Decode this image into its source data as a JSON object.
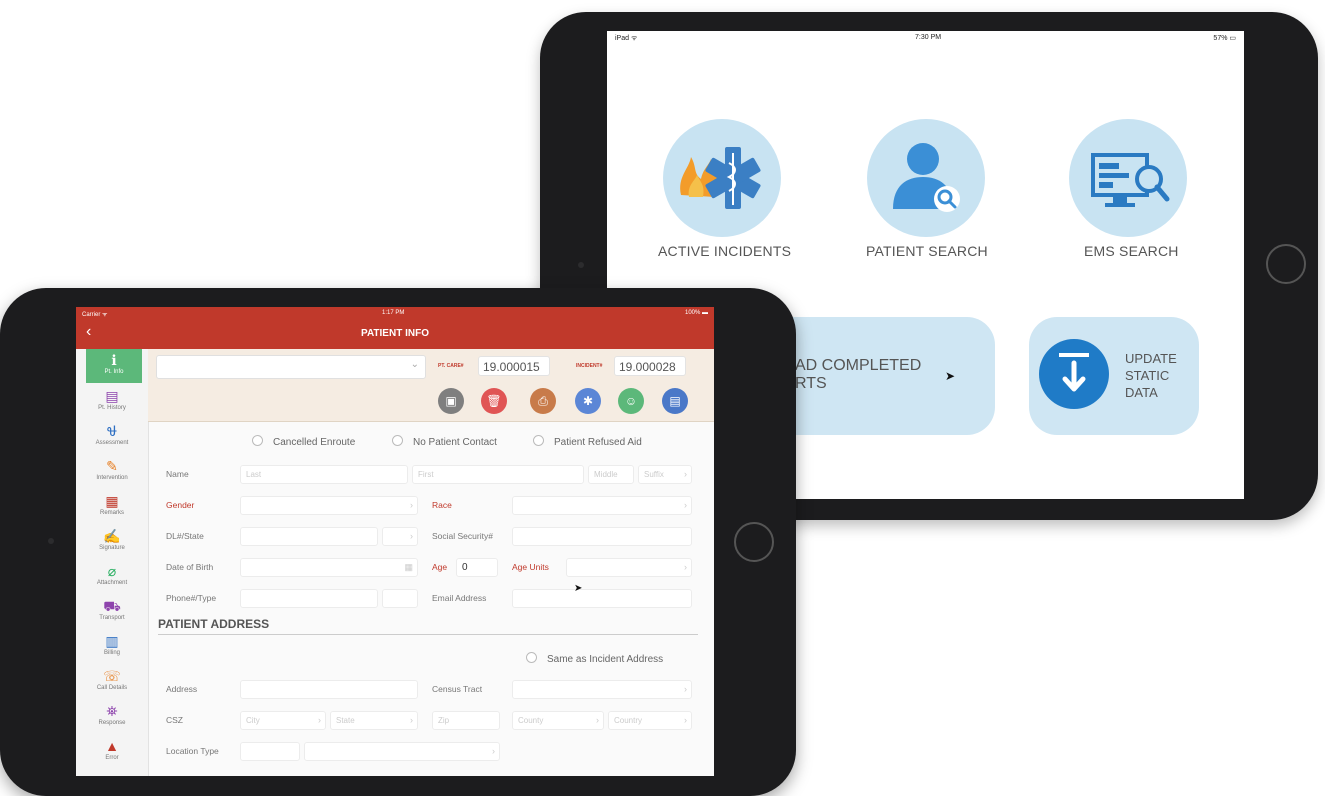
{
  "back_ipad": {
    "status": {
      "carrier": "iPad ᯤ",
      "time": "7:30 PM",
      "battery": "57% ▭"
    },
    "tiles": [
      {
        "label": "ACTIVE INCIDENTS",
        "icon": "medical-fire-icon"
      },
      {
        "label": "PATIENT SEARCH",
        "icon": "person-search-icon"
      },
      {
        "label": "EMS SEARCH",
        "icon": "monitor-search-icon"
      }
    ],
    "cards": [
      {
        "label": "AD COMPLETED\nRTS"
      },
      {
        "label": "UPDATE\nSTATIC\nDATA",
        "icon": "download-icon"
      }
    ]
  },
  "front_ipad": {
    "status": {
      "carrier": "Carrier ᯤ",
      "time": "1:17 PM",
      "battery": "100% ▬"
    },
    "title": "PATIENT INFO",
    "sidebar": [
      {
        "label": "Pt. Info",
        "icon": "info-icon",
        "active": true
      },
      {
        "label": "Pt. History",
        "icon": "clipboard-icon"
      },
      {
        "label": "Assessment",
        "icon": "stethoscope-icon"
      },
      {
        "label": "Intervention",
        "icon": "syringe-icon"
      },
      {
        "label": "Remarks",
        "icon": "notes-icon"
      },
      {
        "label": "Signature",
        "icon": "signature-icon"
      },
      {
        "label": "Attachment",
        "icon": "paperclip-icon"
      },
      {
        "label": "Transport",
        "icon": "ambulance-icon"
      },
      {
        "label": "Billing",
        "icon": "billing-icon"
      },
      {
        "label": "Call Details",
        "icon": "phone-icon"
      },
      {
        "label": "Response",
        "icon": "response-icon"
      },
      {
        "label": "Error",
        "icon": "warning-icon"
      }
    ],
    "topbar": {
      "pt_care_label": "PT. CARE#",
      "pt_care_value": "19.000015",
      "incident_label": "INCIDENT#",
      "incident_value": "19.000028",
      "actions": [
        {
          "icon": "camera-icon",
          "color": "#7f7f7f"
        },
        {
          "icon": "trash-icon",
          "color": "#e05555"
        },
        {
          "icon": "print-icon",
          "color": "#c87b4a"
        },
        {
          "icon": "star-of-life-icon",
          "color": "#5b86d6"
        },
        {
          "icon": "person-icon",
          "color": "#5cb87a"
        },
        {
          "icon": "save-icon",
          "color": "#4a78c8"
        }
      ]
    },
    "form": {
      "options": [
        "Cancelled Enroute",
        "No Patient Contact",
        "Patient Refused Aid"
      ],
      "name_label": "Name",
      "name_placeholders": {
        "last": "Last",
        "first": "First",
        "middle": "Middle",
        "suffix": "Suffix"
      },
      "gender_label": "Gender",
      "race_label": "Race",
      "dl_label": "DL#/State",
      "ssn_label": "Social Security#",
      "dob_label": "Date of Birth",
      "age_label": "Age",
      "age_value": "0",
      "age_units_label": "Age Units",
      "phone_label": "Phone#/Type",
      "email_label": "Email Address",
      "address_section": "PATIENT ADDRESS",
      "same_as_incident": "Same as Incident Address",
      "address_label": "Address",
      "census_label": "Census Tract",
      "csz_label": "CSZ",
      "csz_placeholders": {
        "city": "City",
        "state": "State",
        "zip": "Zip",
        "county": "County",
        "country": "Country"
      },
      "location_type_label": "Location Type"
    }
  }
}
